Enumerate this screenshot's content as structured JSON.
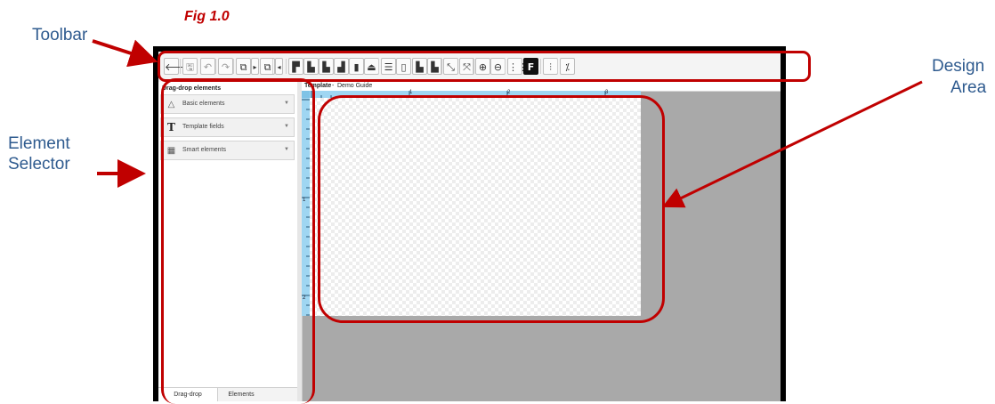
{
  "figure_caption": "Fig 1.0",
  "callouts": {
    "toolbar": "Toolbar",
    "element_selector_line1": "Element",
    "element_selector_line2": "Selector",
    "design_area_line1": "Design",
    "design_area_line2": "Area"
  },
  "colors": {
    "annotation_red": "#c00000",
    "callout_blue": "#2f5b8f",
    "ruler_blue": "#9fd6f2",
    "workspace_gray": "#a9a9a9"
  },
  "toolbar": {
    "buttons": [
      {
        "name": "back-arrow-icon",
        "glyph": "🡐"
      },
      {
        "name": "save-icon",
        "glyph": "🖫",
        "muted": true
      },
      {
        "name": "undo-icon",
        "glyph": "↶",
        "muted": true
      },
      {
        "name": "redo-icon",
        "glyph": "↷",
        "muted": true
      },
      {
        "name": "copy-icon",
        "glyph": "⧉"
      },
      {
        "name": "expand-right-icon",
        "glyph": "▸"
      },
      {
        "name": "paste-icon",
        "glyph": "⧉"
      },
      {
        "name": "expand-left-icon",
        "glyph": "◂"
      },
      {
        "name": "align-top-left-icon",
        "glyph": "▛"
      },
      {
        "name": "align-bottom-left-icon",
        "glyph": "▙"
      },
      {
        "name": "align-left-icon",
        "glyph": "▙"
      },
      {
        "name": "align-right-icon",
        "glyph": "▟"
      },
      {
        "name": "align-center-icon",
        "glyph": "▮"
      },
      {
        "name": "align-middle-icon",
        "glyph": "⏏"
      },
      {
        "name": "distribute-vertical-icon",
        "glyph": "☰"
      },
      {
        "name": "distribute-horizontal-icon",
        "glyph": "▯"
      },
      {
        "name": "same-height-icon",
        "glyph": "▙"
      },
      {
        "name": "same-width-icon",
        "glyph": "▙"
      },
      {
        "name": "resize-icon",
        "glyph": "⤡"
      },
      {
        "name": "fit-icon",
        "glyph": "⤧"
      },
      {
        "name": "zoom-in-icon",
        "glyph": "⊕"
      },
      {
        "name": "zoom-out-icon",
        "glyph": "⊖"
      },
      {
        "name": "grid-icon",
        "glyph": "⋮⋮"
      },
      {
        "name": "font-icon",
        "glyph": "F",
        "dark": true
      },
      {
        "name": "sliders-icon",
        "glyph": "⫶"
      },
      {
        "name": "magic-wand-icon",
        "glyph": "⁒"
      }
    ]
  },
  "panel": {
    "title": "Drag-drop elements",
    "sections": [
      {
        "label": "Basic elements",
        "icon": "shapes-icon",
        "glyph": "△"
      },
      {
        "label": "Template fields",
        "icon": "text-field-icon",
        "glyph": "T"
      },
      {
        "label": "Smart elements",
        "icon": "smart-element-icon",
        "glyph": "▦"
      }
    ],
    "tabs": [
      "Drag-drop",
      "Elements"
    ]
  },
  "design_header": {
    "title": "Template",
    "separator": "-",
    "name": "Demo Guide"
  },
  "ruler": {
    "top_labels": [
      "1",
      "2",
      "3"
    ],
    "left_labels": [
      "1",
      "2"
    ]
  }
}
